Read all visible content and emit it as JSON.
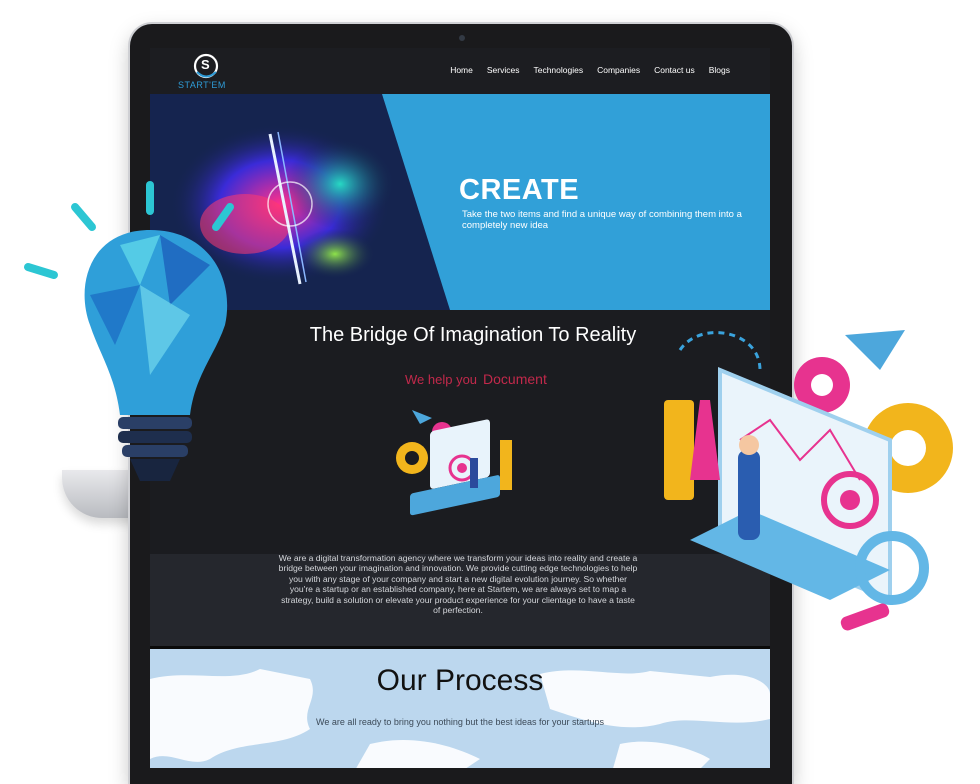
{
  "brand": {
    "name": "START'EM",
    "logo_letter": "S"
  },
  "nav": {
    "items": [
      "Home",
      "Services",
      "Technologies",
      "Companies",
      "Contact us",
      "Blogs"
    ]
  },
  "hero": {
    "title": "CREATE",
    "subtitle": "Take the two items and find a unique way of combining them into a completely new idea"
  },
  "intro": {
    "heading": "The Bridge Of Imagination To Reality",
    "help_prefix": "We help you",
    "help_word": "Document",
    "body": "We are a digital transformation agency where we transform your ideas into reality and create a bridge between your imagination and innovation. We provide cutting edge technologies to help you with any stage of your company and start a new digital evolution journey. So whether you're a startup or an established company, here at Startem, we are always set to map a strategy, build a solution or elevate your product experience for your clientage to have a taste of perfection."
  },
  "process": {
    "title": "Our Process",
    "subtitle": "We are all ready to bring you nothing but the best ideas for your startups"
  },
  "colors": {
    "accent_blue": "#31a0d8",
    "accent_red": "#c2294b",
    "dark_bg": "#1b1c20"
  }
}
